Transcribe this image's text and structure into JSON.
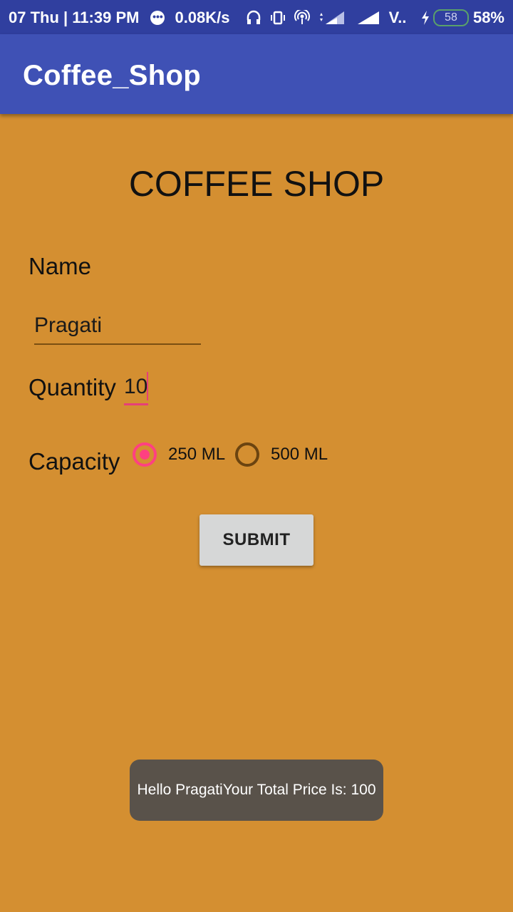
{
  "status_bar": {
    "date_time": "07 Thu | 11:39 PM",
    "notification_icon": "more-dots-icon",
    "speed": "0.08K/s",
    "carrier": "V..",
    "battery_level": "58",
    "battery_percent": "58%"
  },
  "app_bar": {
    "title": "Coffee_Shop"
  },
  "form": {
    "heading": "COFFEE SHOP",
    "name_label": "Name",
    "name_value": "Pragati",
    "quantity_label": "Quantity",
    "quantity_value": "10",
    "capacity_label": "Capacity",
    "capacity_options": [
      {
        "label": "250 ML",
        "selected": true
      },
      {
        "label": "500 ML",
        "selected": false
      }
    ],
    "submit_label": "SUBMIT"
  },
  "toast": {
    "message": "Hello PragatiYour Total Price Is: 100"
  },
  "colors": {
    "background": "#d48f31",
    "app_bar": "#3f51b5",
    "status_bar": "#303f9f",
    "accent": "#ff4081"
  }
}
